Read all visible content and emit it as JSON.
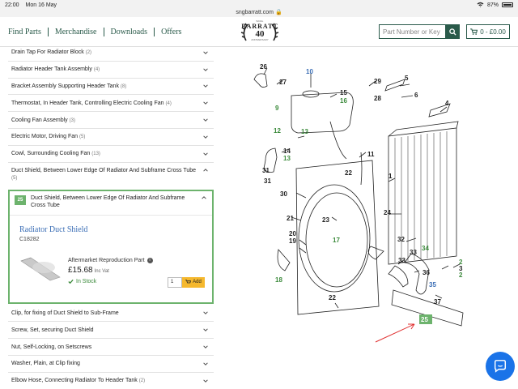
{
  "status": {
    "time": "22:00",
    "date": "Mon 16 May",
    "battery": "87%",
    "url": "sngbarratt.com"
  },
  "nav": {
    "links": [
      "Find Parts",
      "Merchandise",
      "Downloads",
      "Offers"
    ],
    "logo_top": "S.N.G.",
    "logo_brand": "BARRATT",
    "logo_forty": "40",
    "logo_sub": "ANNIVERSARY",
    "search_placeholder": "Part Number or Key",
    "cart_label": "0 - £0.00"
  },
  "categories_top": [
    {
      "label": "Drain Tap For Radiator Block",
      "count": "(2)"
    },
    {
      "label": "Radiator Header Tank Assembly",
      "count": "(4)"
    },
    {
      "label": "Bracket Assembly Supporting Header Tank",
      "count": "(8)"
    },
    {
      "label": "Thermostat, In Header Tank, Controlling Electric Cooling Fan",
      "count": "(4)"
    },
    {
      "label": "Cooling Fan Assembly",
      "count": "(3)"
    },
    {
      "label": "Electric Motor, Driving Fan",
      "count": "(5)"
    },
    {
      "label": "Cowl, Surrounding Cooling Fan",
      "count": "(13)"
    }
  ],
  "open_category": {
    "label": "Duct Shield, Between Lower Edge Of Radiator And Subframe Cross Tube",
    "count": "(5)"
  },
  "expanded_item": {
    "number": "25",
    "label": "Duct Shield, Between Lower Edge Of Radiator And Subframe Cross Tube",
    "product_title": "Radiator Duct Shield",
    "product_code": "C18282",
    "product_type": "Aftermarket Reproduction Part",
    "price": "£15.68",
    "price_note": "Inc Vat",
    "stock": "In Stock",
    "qty": "1",
    "add_label": "Add"
  },
  "categories_bottom": [
    {
      "label": "Clip, for fixing of Duct Shield to Sub-Frame",
      "count": ""
    },
    {
      "label": "Screw, Set, securing Duct Shield",
      "count": ""
    },
    {
      "label": "Nut, Self-Locking, on Setscrews",
      "count": ""
    },
    {
      "label": "Washer, Plain, at Clip fixing",
      "count": ""
    },
    {
      "label": "Elbow Hose, Connecting Radiator To Header Tank",
      "count": "(2)"
    }
  ],
  "diagram_labels": {
    "black": [
      "26",
      "27",
      "29",
      "28",
      "15",
      "5",
      "6",
      "4",
      "14",
      "31",
      "11",
      "1",
      "22",
      "30",
      "21",
      "23",
      "24",
      "20",
      "19",
      "32",
      "33",
      "34",
      "2",
      "3",
      "36",
      "37",
      "22b",
      "18",
      "17",
      "8"
    ],
    "blue": [
      "10",
      "35"
    ],
    "green": [
      "9",
      "12",
      "13",
      "16",
      "13b",
      "17",
      "34",
      "2",
      "2b",
      "18",
      "25"
    ]
  },
  "diagram_text": {
    "n26": "26",
    "n27": "27",
    "n10": "10",
    "n29": "29",
    "n28": "28",
    "n15": "15",
    "n16": "16",
    "n5": "5",
    "n6": "6",
    "n4": "4",
    "n9": "9",
    "n12": "12",
    "n13a": "13",
    "n14": "14",
    "n13b": "13",
    "n31a": "31",
    "n11": "11",
    "n1": "1",
    "n22a": "22",
    "n31b": "31",
    "n30": "30",
    "n21": "21",
    "n23": "23",
    "n24": "24",
    "n20": "20",
    "n19": "19",
    "n17": "17",
    "n32": "32",
    "n33a": "33",
    "n33b": "33",
    "n34": "34",
    "n2a": "2",
    "n3": "3",
    "n2b": "2",
    "n36": "36",
    "n35": "35",
    "n18": "18",
    "n22b": "22",
    "n37": "37",
    "n25": "25",
    "n8": "8",
    "n7": "7"
  },
  "colors": {
    "green": "#6db36d",
    "brand": "#2a5a4a",
    "link": "#3b6eb5",
    "accent": "#f5b82e",
    "arrow": "#e03030"
  }
}
